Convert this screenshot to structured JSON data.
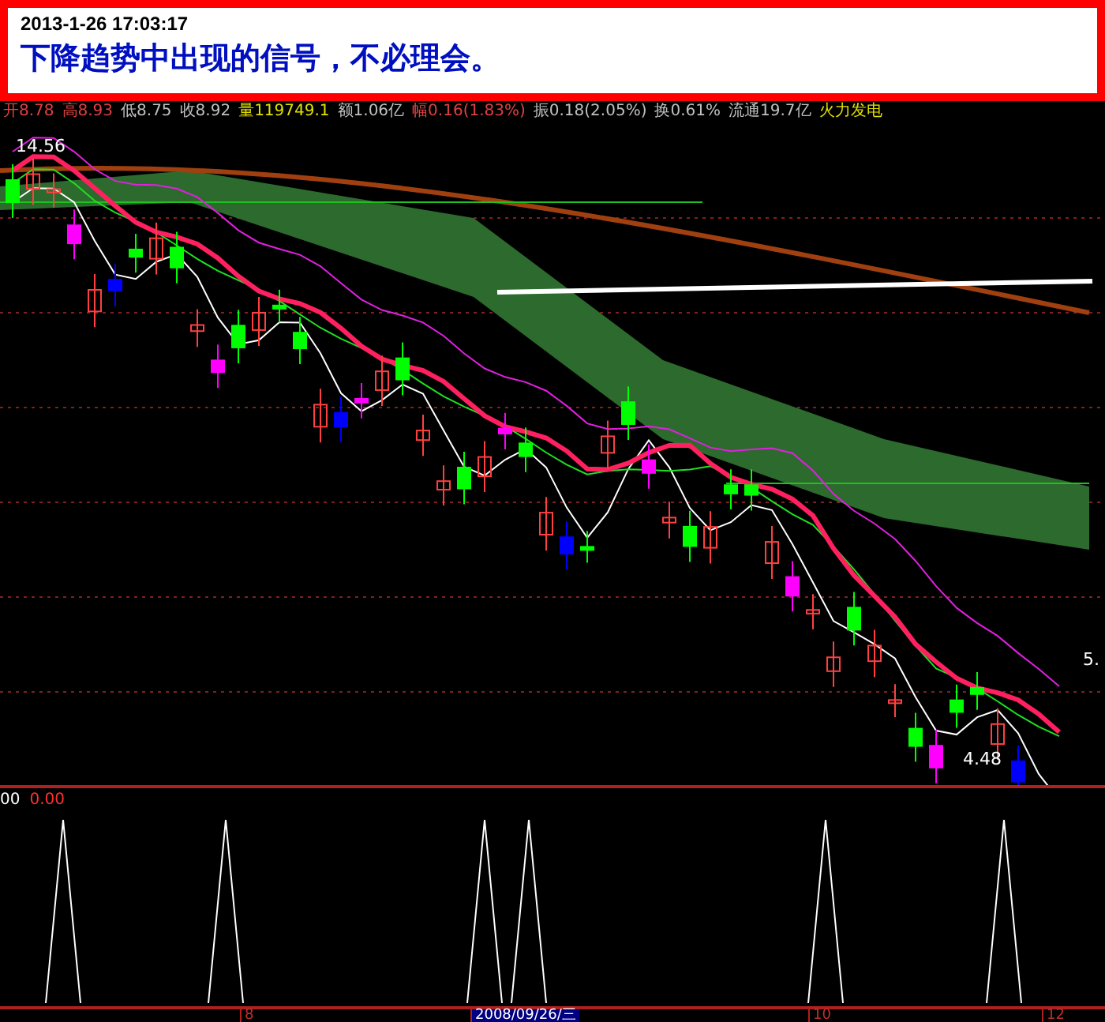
{
  "header": {
    "timestamp": "2013-1-26 17:03:17",
    "message": "下降趋势中出现的信号，不必理会。"
  },
  "quote_line": [
    {
      "text": "开8.78",
      "color": "#e04040"
    },
    {
      "text": "高8.93",
      "color": "#e04040"
    },
    {
      "text": "低8.75",
      "color": "#c0c0c0"
    },
    {
      "text": "收8.92",
      "color": "#c0c0c0"
    },
    {
      "text": "量119749.1",
      "color": "#e0e000"
    },
    {
      "text": "额1.06亿",
      "color": "#c0c0c0"
    },
    {
      "text": "幅0.16(1.83%)",
      "color": "#e04040"
    },
    {
      "text": "振0.18(2.05%)",
      "color": "#c0c0c0"
    },
    {
      "text": "换0.61%",
      "color": "#c0c0c0"
    },
    {
      "text": "流通19.7亿",
      "color": "#c0c0c0"
    },
    {
      "text": "火力发电",
      "color": "#e0e000"
    }
  ],
  "price_chart": {
    "high_label": "14.56",
    "low_label": "4.48",
    "right_label": "5."
  },
  "indicator_panel": {
    "name": "00",
    "value": "0.00"
  },
  "time_axis": [
    {
      "text": "8",
      "selected": false
    },
    {
      "text": "2008/09/26/三",
      "selected": true
    },
    {
      "text": "10",
      "selected": false
    },
    {
      "text": "12",
      "selected": false
    }
  ]
}
